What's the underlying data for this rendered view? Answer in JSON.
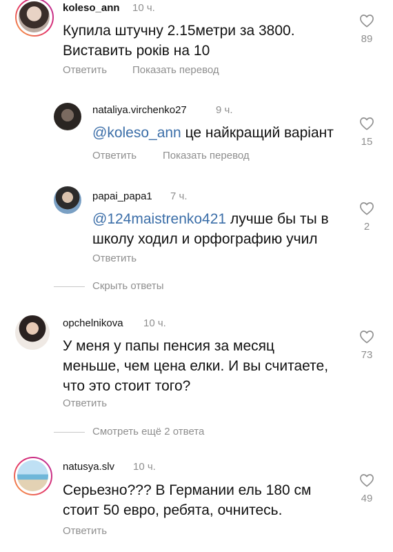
{
  "comments": [
    {
      "username": "koleso_ann",
      "time": "10 ч.",
      "text_lines": [
        "Купила штучну 2.15метри за 3800.",
        "Виставить років на 10"
      ],
      "likes": "89",
      "reply_label": "Ответить",
      "translate_label": "Показать перевод"
    },
    {
      "username": "nataliya.virchenko27",
      "time": "9 ч.",
      "mention": "@koleso_ann",
      "text": " це найкращий варіант",
      "likes": "15",
      "reply_label": "Ответить",
      "translate_label": "Показать перевод"
    },
    {
      "username": "papai_papa1",
      "time": "7 ч.",
      "mention": "@124maistrenko421",
      "text_line1": " лучше бы ты в",
      "text_line2": "школу ходил и орфографию учил",
      "likes": "2",
      "reply_label": "Ответить"
    },
    {
      "username": "opchelnikova",
      "time": "10 ч.",
      "text_lines": [
        "У меня у папы пенсия за месяц",
        "меньше, чем цена елки. И вы считаете,",
        "что это стоит того?"
      ],
      "likes": "73",
      "reply_label": "Ответить"
    },
    {
      "username": "natusya.slv",
      "time": "10 ч.",
      "text_lines": [
        "Серьезно??? В Германии ель 180 см",
        "стоит 50 евро, ребята, очнитесь."
      ],
      "likes": "49",
      "reply_label": "Ответить"
    }
  ],
  "threads": {
    "hide_replies": "Скрыть ответы",
    "more_replies": "Смотреть ещё 2 ответа"
  },
  "icons": {
    "like": "heart-outline-icon"
  },
  "colors": {
    "mention": "#3b6ea8",
    "secondary_text": "#8e8e8e"
  }
}
